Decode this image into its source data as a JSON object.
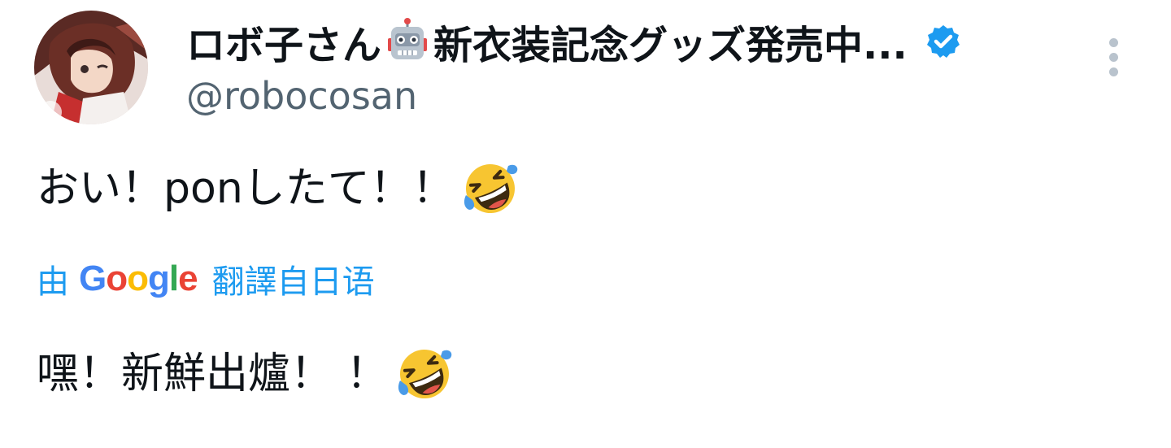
{
  "author": {
    "display_name": "ロボ子さん",
    "display_name_suffix": "新衣装記念グッズ発売中...",
    "handle": "@robocosan",
    "verified": true
  },
  "tweet": {
    "text": "おい！ponしたて！！",
    "emoji": "rolling-on-the-floor-laughing"
  },
  "translation": {
    "prefix": "由",
    "provider_letters": [
      "G",
      "o",
      "o",
      "g",
      "l",
      "e"
    ],
    "provider_colors": [
      "#4285F4",
      "#EA4335",
      "#FBBC05",
      "#4285F4",
      "#34A853",
      "#EA4335"
    ],
    "suffix": "翻譯自日语",
    "text": "嘿！新鮮出爐！ ！",
    "emoji": "rolling-on-the-floor-laughing"
  },
  "colors": {
    "accent": "#1d9bf0",
    "verified": "#1d9bf0",
    "secondary_text": "#536471"
  }
}
